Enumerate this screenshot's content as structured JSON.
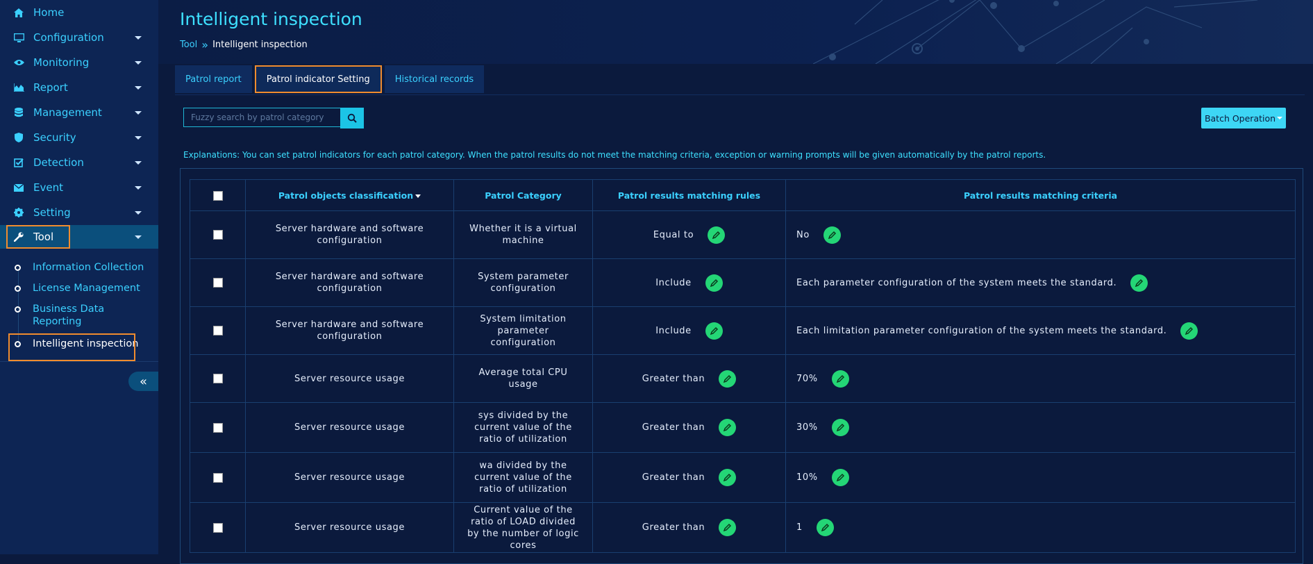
{
  "sidebar": {
    "items": [
      {
        "label": "Home",
        "icon": "home-icon",
        "has_caret": false
      },
      {
        "label": "Configuration",
        "icon": "monitor-icon",
        "has_caret": true
      },
      {
        "label": "Monitoring",
        "icon": "eye-icon",
        "has_caret": true
      },
      {
        "label": "Report",
        "icon": "area-chart-icon",
        "has_caret": true
      },
      {
        "label": "Management",
        "icon": "database-icon",
        "has_caret": true
      },
      {
        "label": "Security",
        "icon": "shield-icon",
        "has_caret": true
      },
      {
        "label": "Detection",
        "icon": "check-square-icon",
        "has_caret": true
      },
      {
        "label": "Event",
        "icon": "envelope-icon",
        "has_caret": true
      },
      {
        "label": "Setting",
        "icon": "gear-icon",
        "has_caret": true
      },
      {
        "label": "Tool",
        "icon": "wrench-icon",
        "has_caret": true
      }
    ],
    "sub_items": [
      {
        "label": "Information Collection"
      },
      {
        "label": "License Management"
      },
      {
        "label": "Business Data Reporting"
      },
      {
        "label": "Intelligent inspection"
      }
    ],
    "collapse_glyph": "«"
  },
  "header": {
    "title": "Intelligent inspection",
    "breadcrumb": {
      "parent": "Tool",
      "separator": "»",
      "current": "Intelligent inspection"
    }
  },
  "tabs": [
    {
      "label": "Patrol report"
    },
    {
      "label": "Patrol indicator Setting"
    },
    {
      "label": "Historical records"
    }
  ],
  "search": {
    "placeholder": "Fuzzy search by patrol category"
  },
  "batch_button": {
    "label": "Batch Operation"
  },
  "explanation": "Explanations: You can set patrol indicators for each patrol category. When the patrol results do not meet the matching criteria, exception or warning prompts will be given automatically by the patrol reports.",
  "table": {
    "headers": {
      "classification": "Patrol objects classification",
      "category": "Patrol Category",
      "rules": "Patrol results matching rules",
      "criteria": "Patrol results matching criteria"
    },
    "rows": [
      {
        "classification": "Server hardware and software configuration",
        "category": "Whether it is a virtual machine",
        "rule": "Equal to",
        "criteria": "No"
      },
      {
        "classification": "Server hardware and software configuration",
        "category": "System parameter configuration",
        "rule": "Include",
        "criteria": "Each parameter configuration of the system meets the standard."
      },
      {
        "classification": "Server hardware and software configuration",
        "category": "System limitation parameter configuration",
        "rule": "Include",
        "criteria": "Each limitation parameter configuration of the system meets the standard."
      },
      {
        "classification": "Server resource usage",
        "category": "Average total CPU usage",
        "rule": "Greater than",
        "criteria": "70%"
      },
      {
        "classification": "Server resource usage",
        "category": "sys divided by the current value of the ratio of utilization",
        "rule": "Greater than",
        "criteria": "30%"
      },
      {
        "classification": "Server resource usage",
        "category": "wa divided by the current value of the ratio of utilization",
        "rule": "Greater than",
        "criteria": "10%"
      },
      {
        "classification": "Server resource usage",
        "category": "Current value of the ratio of LOAD divided by the number of logic cores",
        "rule": "Greater than",
        "criteria": "1"
      }
    ]
  },
  "colors": {
    "accent": "#3bd0ff",
    "highlight": "#f08c2e",
    "edit_button": "#24d676",
    "background": "#0b1a3d",
    "sidebar": "#0d2554"
  }
}
